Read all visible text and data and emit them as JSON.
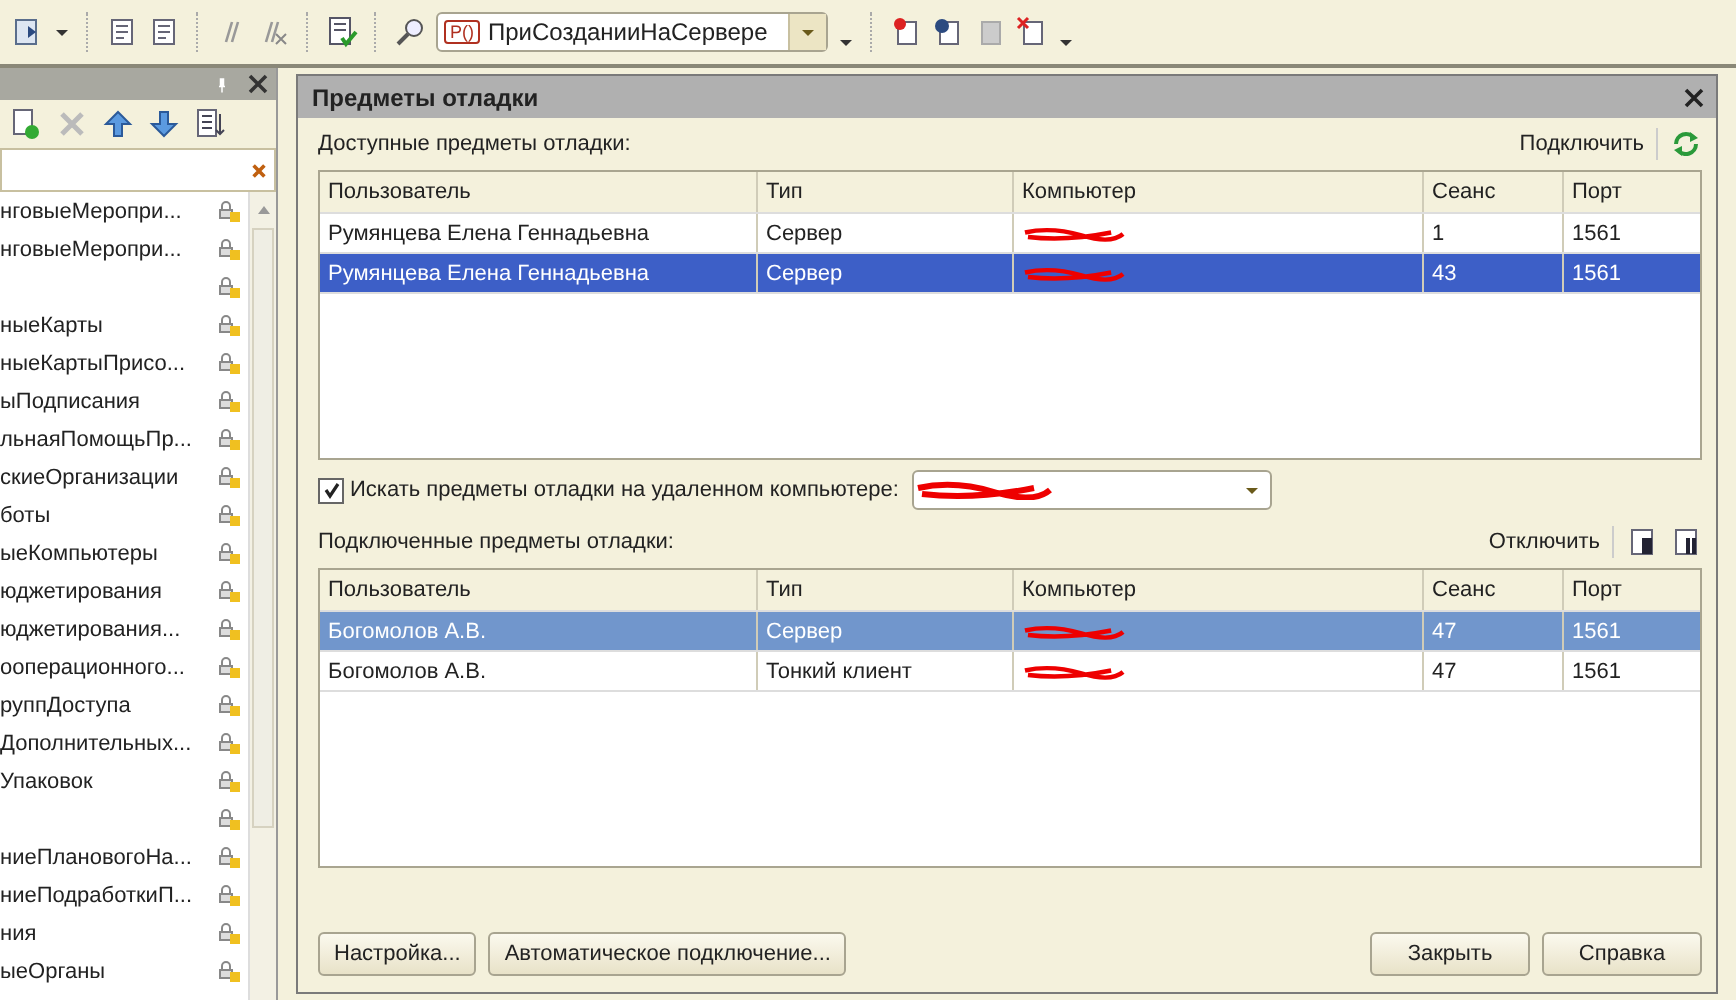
{
  "toolbar": {
    "procedure": {
      "badge": "P()",
      "value": "ПриСозданииНаСервере"
    }
  },
  "sidebar": {
    "items": [
      {
        "kind": "entry",
        "label": "нговыеМеропри..."
      },
      {
        "kind": "entry",
        "label": "нговыеМеропри..."
      },
      {
        "kind": "blank"
      },
      {
        "kind": "entry",
        "label": "ныеКарты"
      },
      {
        "kind": "entry",
        "label": "ныеКартыПрисо..."
      },
      {
        "kind": "entry",
        "label": "ыПодписания"
      },
      {
        "kind": "entry",
        "label": "льнаяПомощьПр..."
      },
      {
        "kind": "entry",
        "label": "скиеОрганизации"
      },
      {
        "kind": "entry",
        "label": "боты"
      },
      {
        "kind": "entry",
        "label": "ыеКомпьютеры"
      },
      {
        "kind": "entry",
        "label": "юджетирования"
      },
      {
        "kind": "entry",
        "label": "юджетирования..."
      },
      {
        "kind": "entry",
        "label": "ооперационного..."
      },
      {
        "kind": "entry",
        "label": "руппДоступа"
      },
      {
        "kind": "entry",
        "label": "Дополнительных..."
      },
      {
        "kind": "entry",
        "label": "Упаковок"
      },
      {
        "kind": "blank"
      },
      {
        "kind": "entry",
        "label": "ниеПлановогоНа..."
      },
      {
        "kind": "entry",
        "label": "ниеПодработкиП..."
      },
      {
        "kind": "entry",
        "label": "ния"
      },
      {
        "kind": "entry",
        "label": "ыеОрганы"
      }
    ]
  },
  "dialog": {
    "title": "Предметы отладки",
    "available": {
      "label": "Доступные предметы отладки:",
      "action": "Подключить",
      "focused": true,
      "columns": [
        "Пользователь",
        "Тип",
        "Компьютер",
        "Сеанс",
        "Порт"
      ],
      "rows": [
        {
          "user": "Румянцева Елена Геннадьевна",
          "type": "Сервер",
          "session": "1",
          "port": "1561",
          "selected": false
        },
        {
          "user": "Румянцева Елена Геннадьевна",
          "type": "Сервер",
          "session": "43",
          "port": "1561",
          "selected": true
        }
      ]
    },
    "remote": {
      "label": "Искать предметы отладки на удаленном компьютере:",
      "checked": true
    },
    "connected": {
      "label": "Подключенные предметы отладки:",
      "action": "Отключить",
      "focused": false,
      "columns": [
        "Пользователь",
        "Тип",
        "Компьютер",
        "Сеанс",
        "Порт"
      ],
      "rows": [
        {
          "user": "Богомолов А.В.",
          "type": "Сервер",
          "session": "47",
          "port": "1561",
          "selected": true
        },
        {
          "user": "Богомолов А.В.",
          "type": "Тонкий клиент",
          "session": "47",
          "port": "1561",
          "selected": false
        }
      ]
    },
    "buttons_left": [
      "Настройка...",
      "Автоматическое подключение..."
    ],
    "buttons_right": [
      "Закрыть",
      "Справка"
    ]
  }
}
